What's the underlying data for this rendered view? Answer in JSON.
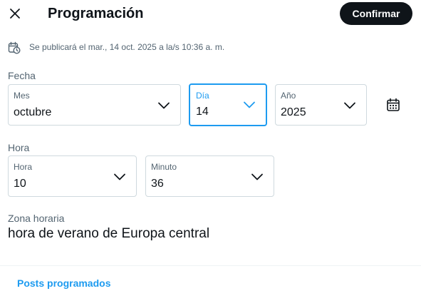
{
  "header": {
    "close_icon": "close-icon",
    "title": "Programación",
    "confirm_label": "Confirmar"
  },
  "schedule_summary": {
    "icon": "calendar-clock-icon",
    "text": "Se publicará el mar., 14 oct. 2025 a la/s 10:36 a. m."
  },
  "date": {
    "section_label": "Fecha",
    "month": {
      "label": "Mes",
      "value": "octubre"
    },
    "day": {
      "label": "Día",
      "value": "14"
    },
    "year": {
      "label": "Año",
      "value": "2025"
    },
    "calendar_icon": "calendar-icon"
  },
  "time": {
    "section_label": "Hora",
    "hour": {
      "label": "Hora",
      "value": "10"
    },
    "minute": {
      "label": "Minuto",
      "value": "36"
    }
  },
  "timezone": {
    "label": "Zona horaria",
    "value": "hora de verano de Europa central"
  },
  "footer": {
    "scheduled_posts_link": "Posts programados"
  },
  "colors": {
    "accent": "#1d9bf0",
    "text_primary": "#0f1419",
    "text_secondary": "#536471",
    "border": "#cfd9de",
    "button_bg": "#0f1419"
  }
}
